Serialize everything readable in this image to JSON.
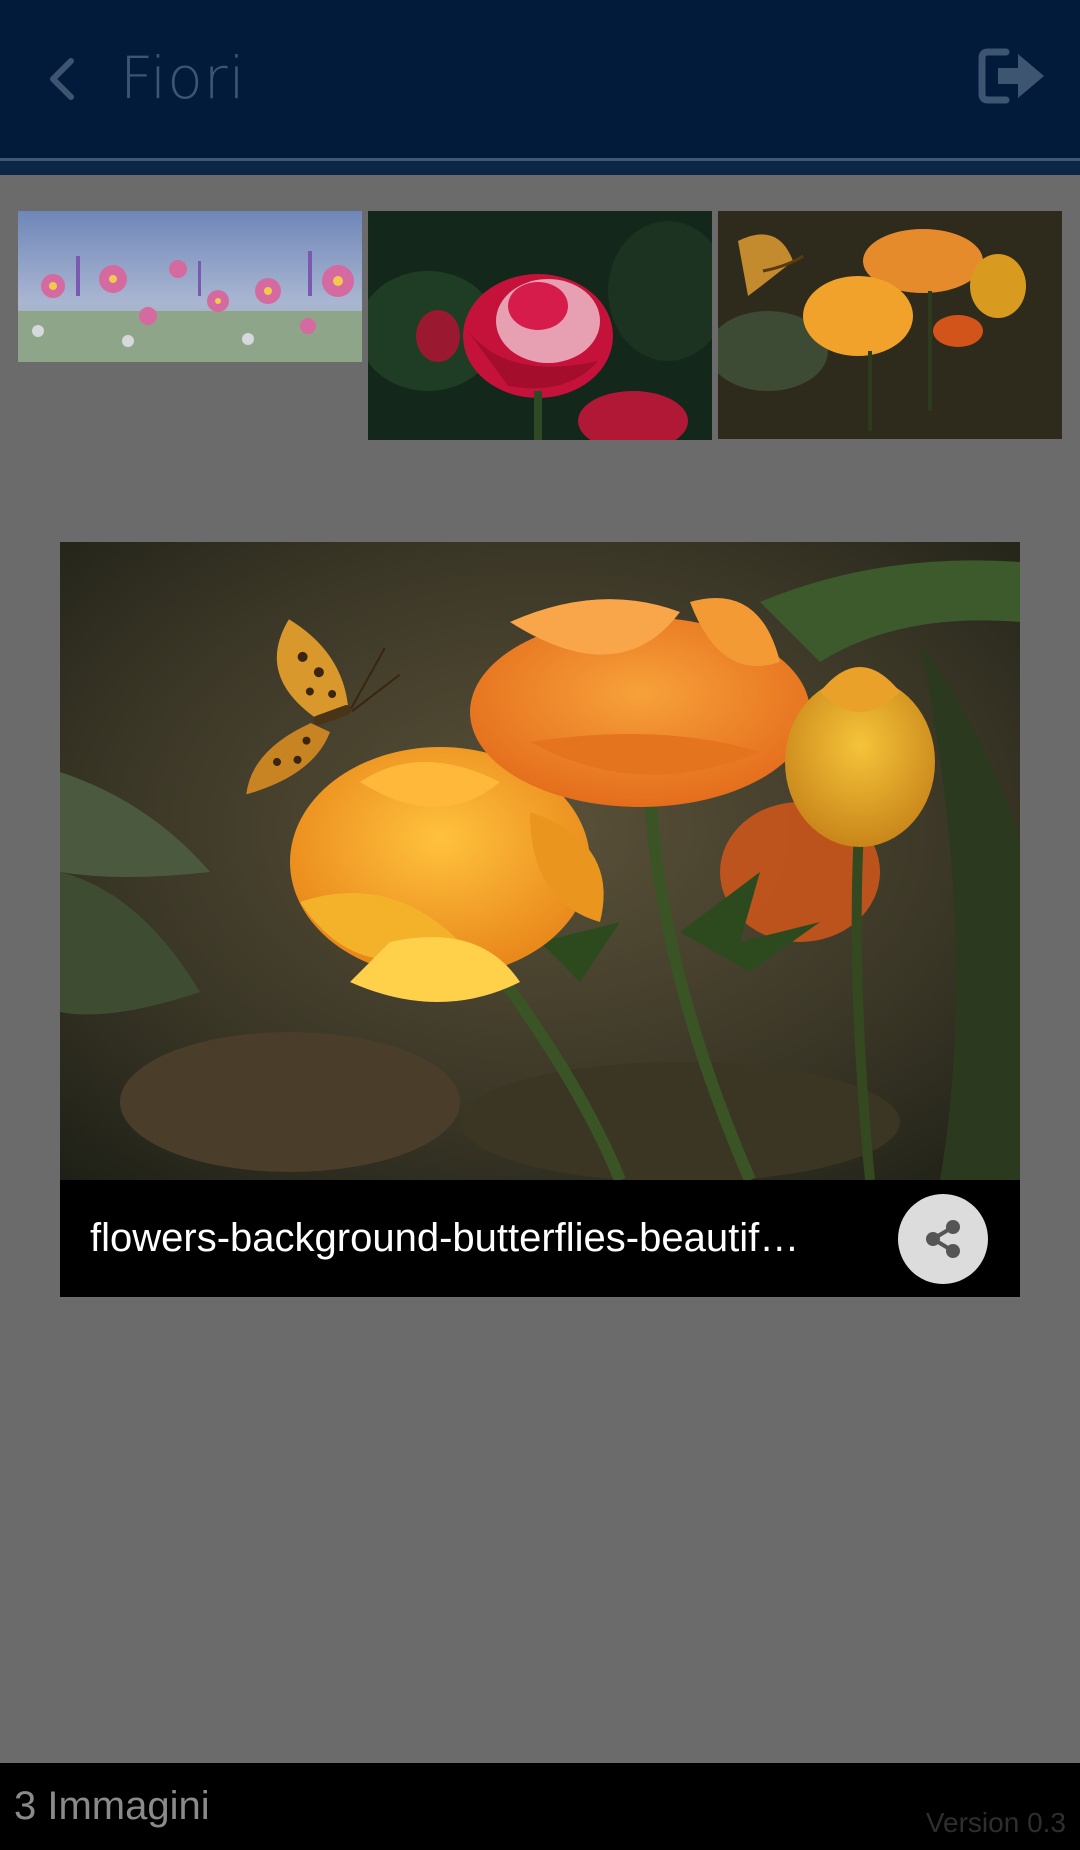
{
  "header": {
    "title": "Fiori",
    "back_icon": "chevron-left-icon",
    "logout_icon": "sign-out-icon",
    "background_color": "#021b3a",
    "title_color": "#3e5572"
  },
  "thumbnails": [
    {
      "subject": "pink cosmos flowers meadow"
    },
    {
      "subject": "red and white rose"
    },
    {
      "subject": "orange flowers with butterfly"
    }
  ],
  "viewer": {
    "caption": "flowers-background-butterflies-beautif…",
    "share_icon": "share-icon"
  },
  "footer": {
    "count_text": "3 Immagini",
    "version_text": "Version 0.3"
  }
}
